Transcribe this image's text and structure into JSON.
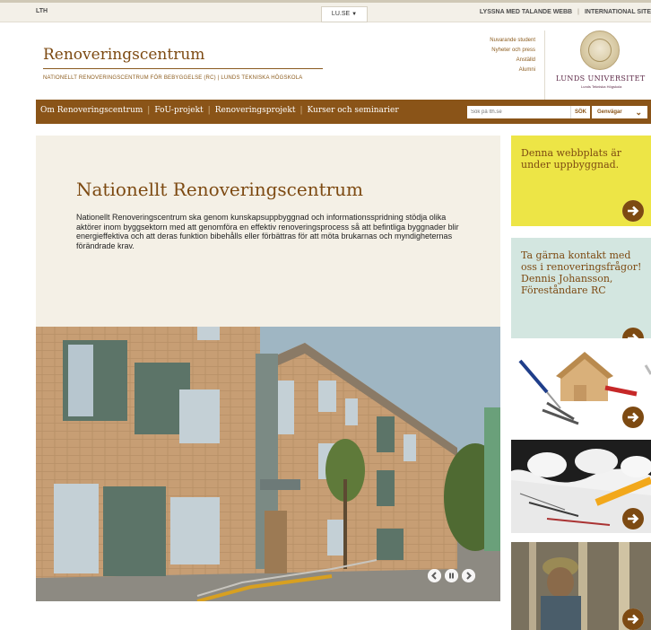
{
  "topbar": {
    "lth": "LTH",
    "luse": "LU.SE",
    "listen": "LYSSNA MED TALANDE WEBB",
    "international": "INTERNATIONAL SITE"
  },
  "header": {
    "title": "Renoveringscentrum",
    "subtitle": "NATIONELLT RENOVERINGSCENTRUM FÖR BEBYGGELSE (RC) | LUNDS TEKNISKA HÖGSKOLA",
    "service_links": [
      "Nuvarande student",
      "Nyheter och press",
      "Anställd",
      "Alumni"
    ],
    "university_name": "LUNDS UNIVERSITET",
    "university_sub": "Lunds Tekniska Högskola"
  },
  "nav": {
    "items": [
      "Om Renoveringscentrum",
      "FoU-projekt",
      "Renoveringsprojekt",
      "Kurser och seminarier"
    ],
    "search_placeholder": "Sök på lth.se",
    "search_button": "SÖK",
    "shortcuts": "Genvägar"
  },
  "intro": {
    "heading": "Nationellt Renoveringscentrum",
    "body": "Nationellt Renoveringscentrum ska genom kunskapsuppbyggnad och informationsspridning stödja olika aktörer inom byggsektorn med att genomföra en effektiv renoveringsprocess så att befintliga byggnader blir energieffektiva och att deras funktion bibehålls eller förbättras för att möta brukarnas och myndigheternas förändrade krav."
  },
  "sidebar": {
    "card1": "Denna webbplats är under uppbyggnad.",
    "card2": "Ta gärna kontakt med oss i renoveringsfrågor! Dennis Johansson, Föreståndare RC"
  },
  "colors": {
    "brand_brown": "#8a5418",
    "title_brown": "#7d4a12",
    "yellow_card": "#ede546",
    "teal_card": "#d3e6e0",
    "intro_bg": "#f4f0e6"
  }
}
